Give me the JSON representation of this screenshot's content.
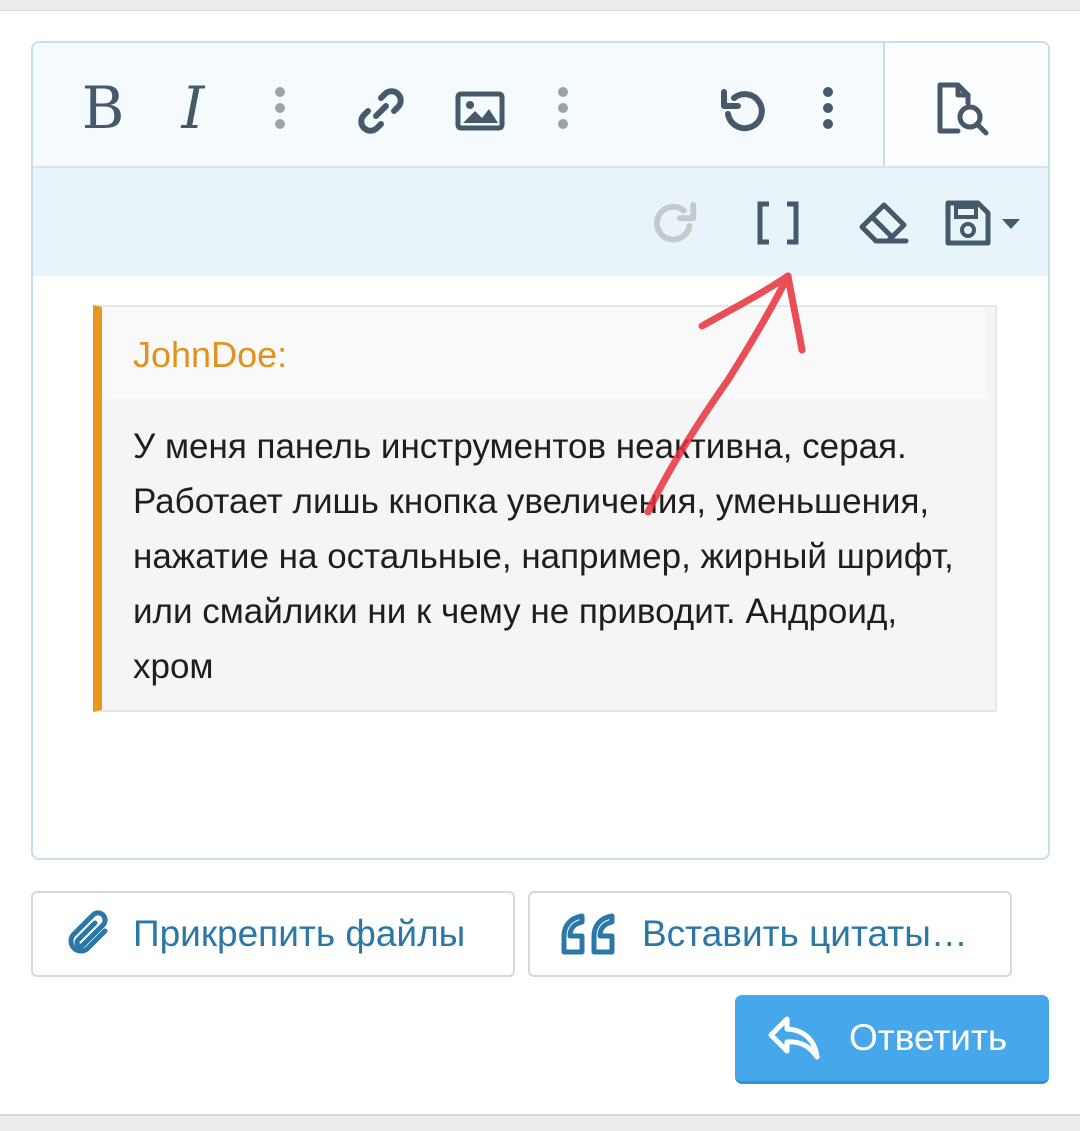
{
  "editor": {
    "toolbar": {
      "bold_label": "B",
      "italic_label": "I",
      "icons": [
        "bold-icon",
        "italic-icon",
        "more-text-options-icon",
        "link-icon",
        "image-icon",
        "more-insert-options-icon",
        "undo-icon",
        "more-options-icon",
        "preview-icon",
        "redo-icon",
        "bbcode-toggle-icon",
        "remove-formatting-icon",
        "drafts-icon"
      ]
    },
    "quote": {
      "author": "JohnDoe:",
      "text": "У меня панель инструментов неактивна, серая. Работает лишь кнопка увеличения, уменьшения, нажатие на остальные, например, жирный шрифт, или смайлики ни к чему не приводит. Андроид, хром"
    }
  },
  "actions": {
    "attach_label": "Прикрепить файлы",
    "insert_quotes_label": "Вставить цитаты…",
    "reply_label": "Ответить"
  },
  "colors": {
    "icon": "#45596b",
    "accent_orange": "#e8961f",
    "link_blue": "#2b77a7",
    "primary_button": "#47a7eb",
    "annotation_red": "#e8303a"
  }
}
